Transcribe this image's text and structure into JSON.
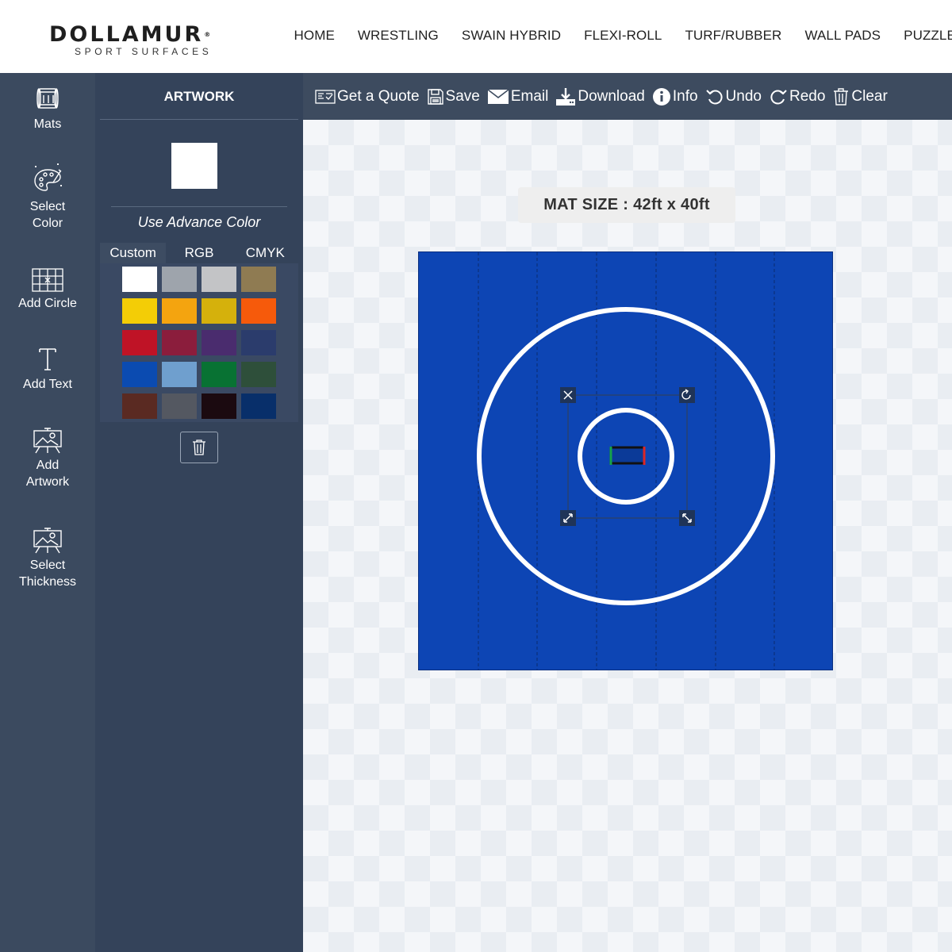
{
  "header": {
    "logo_main": "DOLLAMUR",
    "logo_reg": "®",
    "logo_sub": "SPORT SURFACES",
    "nav": [
      "HOME",
      "WRESTLING",
      "SWAIN HYBRID",
      "FLEXI-ROLL",
      "TURF/RUBBER",
      "WALL PADS",
      "PUZZLE"
    ]
  },
  "rail": {
    "items": [
      {
        "label_lines": [
          "Mats"
        ],
        "icon": "mat-roll-icon"
      },
      {
        "label_lines": [
          "Select",
          "Color"
        ],
        "icon": "palette-icon"
      },
      {
        "label_lines": [
          "Add Circle"
        ],
        "icon": "grid-circle-icon"
      },
      {
        "label_lines": [
          "Add Text"
        ],
        "icon": "text-icon"
      },
      {
        "label_lines": [
          "Add",
          "Artwork"
        ],
        "icon": "easel-icon"
      },
      {
        "label_lines": [
          "Select",
          "Thickness"
        ],
        "icon": "easel-icon"
      }
    ]
  },
  "panel": {
    "title": "ARTWORK",
    "selected_color": "#ffffff",
    "advance_color_label": "Use Advance Color",
    "modes": [
      "Custom",
      "RGB",
      "CMYK"
    ],
    "active_mode": "Custom",
    "swatches": [
      [
        "#ffffff",
        "#9ea4ac",
        "#c3c4c6",
        "#8f7b52"
      ],
      [
        "#f3cd06",
        "#f4a40f",
        "#d5b10c",
        "#f65a0b"
      ],
      [
        "#bf1326",
        "#8b1d3c",
        "#4a2c6e",
        "#2b3c6c"
      ],
      [
        "#0b4bb1",
        "#6f9fce",
        "#087233",
        "#2e4f3a"
      ],
      [
        "#5a2a22",
        "#545861",
        "#1b0a10",
        "#082f6a"
      ]
    ]
  },
  "toolbar": {
    "buttons": [
      {
        "label": "Get a Quote",
        "icon": "quote-icon"
      },
      {
        "label": "Save",
        "icon": "save-icon"
      },
      {
        "label": "Email",
        "icon": "email-icon"
      },
      {
        "label": "Download",
        "icon": "download-icon"
      },
      {
        "label": "Info",
        "icon": "info-icon"
      },
      {
        "label": "Undo",
        "icon": "undo-icon"
      },
      {
        "label": "Redo",
        "icon": "redo-icon"
      },
      {
        "label": "Clear",
        "icon": "trash-icon"
      }
    ]
  },
  "canvas": {
    "mat_size": "MAT SIZE : 42ft x 40ft",
    "mat_color": "#0d45b4",
    "line_color": "#ffffff",
    "seam_count": 6
  }
}
